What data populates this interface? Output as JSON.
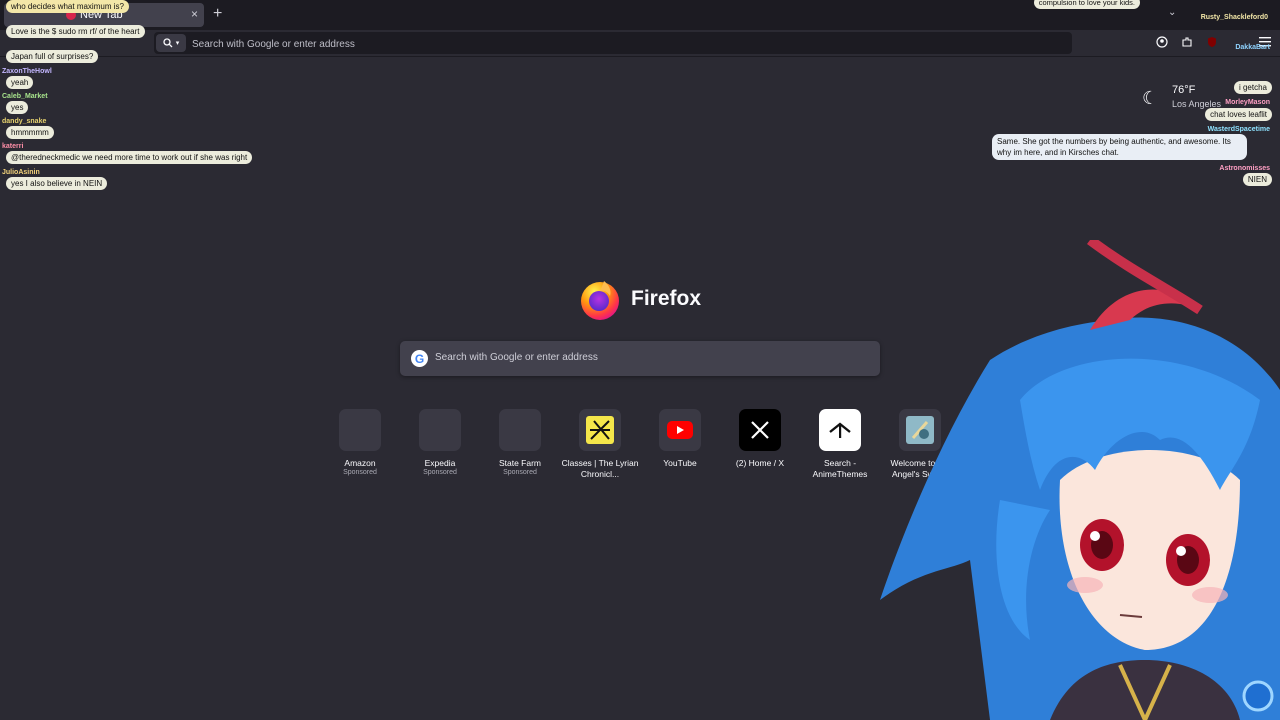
{
  "browser": {
    "tab_title": "New Tab",
    "tab_close": "×",
    "new_tab": "+",
    "tablist": "⌄",
    "search_mode_icon": "search-icon",
    "urlbar_placeholder": "Search with Google or enter address"
  },
  "weather": {
    "temp": "76°F",
    "location": "Los Angeles"
  },
  "brand": {
    "wordmark": "Firefox"
  },
  "search": {
    "placeholder": "Search with Google or enter address"
  },
  "shortcuts": [
    {
      "label": "Amazon",
      "sponsor": "Sponsored"
    },
    {
      "label": "Expedia",
      "sponsor": "Sponsored"
    },
    {
      "label": "State Farm",
      "sponsor": "Sponsored"
    },
    {
      "label": "Classes | The Lyrian Chronicl...",
      "sponsor": ""
    },
    {
      "label": "YouTube",
      "sponsor": ""
    },
    {
      "label": "(2) Home / X",
      "sponsor": ""
    },
    {
      "label": "Search - AnimeThemes",
      "sponsor": ""
    },
    {
      "label": "Welcome to the Angel's Swor...",
      "sponsor": ""
    }
  ],
  "chat_left": [
    {
      "user": "",
      "message": "who decides what maximum is?"
    },
    {
      "user": "",
      "message": "Love is the $ sudo rm rf/ of the heart"
    },
    {
      "user": "",
      "message": "Japan full of surprises?"
    },
    {
      "user": "ZaxonTheHowl",
      "message": "yeah"
    },
    {
      "user": "Caleb_Market",
      "message": "yes"
    },
    {
      "user": "dandy_snake",
      "message": "hmmmmm"
    },
    {
      "user": "katerri",
      "message": "@theredneckmedic we need more time to work out if she was right"
    },
    {
      "user": "JulioAsinin",
      "message": "yes I also believe in NEIN"
    }
  ],
  "chat_right": [
    {
      "user": "",
      "message": "compulsion to love your kids."
    },
    {
      "user": "Rusty_Shackleford0",
      "message": ""
    },
    {
      "user": "DakkaBart",
      "message": ""
    },
    {
      "user": "",
      "message": "i getcha"
    },
    {
      "user": "MorleyMason",
      "message": "chat loves leaflit"
    },
    {
      "user": "WasterdSpacetime",
      "message": "Same. She got the numbers by being authentic, and awesome. Its why im here, and in Kirsches chat."
    },
    {
      "user": "Astronomisses",
      "message": "NIEN"
    }
  ]
}
